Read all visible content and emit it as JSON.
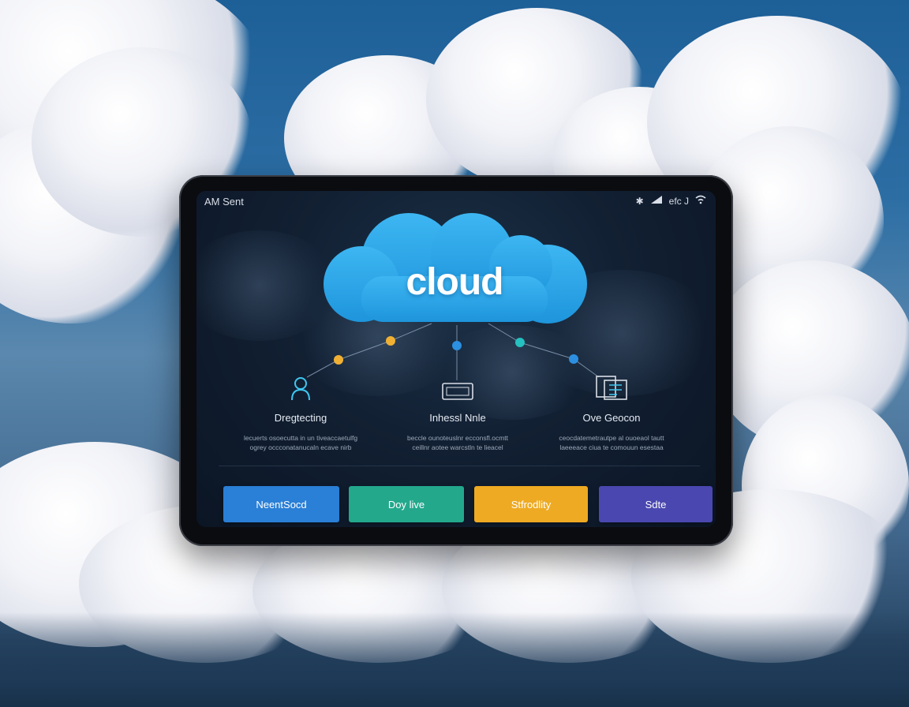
{
  "status_bar": {
    "left_text": "AM Sent",
    "right_text": "efc J"
  },
  "hero": {
    "label": "cloud"
  },
  "features": [
    {
      "title": "Dregtecting",
      "desc_line1": "lecuerts osoecutta in un tiveaccaetulfg",
      "desc_line2": "ogrey occconatanucaln ecave nirb",
      "icon": "user-icon"
    },
    {
      "title": "Inhessl Nnle",
      "desc_line1": "beccle ounoteuslnr ecconsfl.ocmtt",
      "desc_line2": "ceillnr aotee warcstln te lieacel",
      "icon": "server-icon"
    },
    {
      "title": "Ove Geocon",
      "desc_line1": "ceocdatemetrautpe al ouoeaol tautt",
      "desc_line2": "laeeeace ciua te comouun esestaa",
      "icon": "files-icon"
    }
  ],
  "buttons": [
    {
      "label": "NeentSocd",
      "color": "#2a7fd6"
    },
    {
      "label": "Doy live",
      "color": "#23a88c"
    },
    {
      "label": "Stfrodlity",
      "color": "#eeaa22"
    },
    {
      "label": "Sdte",
      "color": "#4a47b0"
    }
  ],
  "colors": {
    "hero_cloud": "#29a6ea",
    "node_orange": "#f0b033",
    "node_blue": "#2c8fe0",
    "node_teal": "#25c0c0",
    "icon_stroke": "#3fc6f0"
  }
}
